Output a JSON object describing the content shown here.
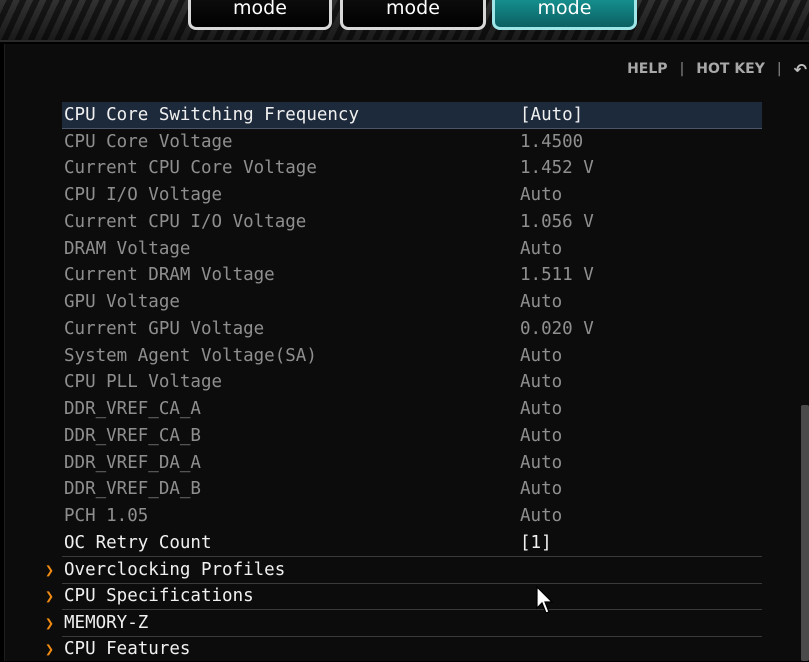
{
  "mode_tabs": [
    {
      "label": "mode",
      "active": false
    },
    {
      "label": "mode",
      "active": false
    },
    {
      "label": "mode",
      "active": true
    }
  ],
  "helpbar": {
    "help": "HELP",
    "separator": "|",
    "hotkey": "HOT KEY",
    "back_icon": "back-arrow-icon"
  },
  "colors": {
    "accent_teal": "#19a3a0",
    "chevron_orange": "#f08a12",
    "selected_row": "#1d2a3b"
  },
  "settings": [
    {
      "label": "CPU Core Switching Frequency",
      "value": "[Auto]"
    },
    {
      "label": "CPU Core Voltage",
      "value": "1.4500"
    },
    {
      "label": "Current CPU Core Voltage",
      "value": "1.452 V"
    },
    {
      "label": "CPU I/O Voltage",
      "value": "Auto"
    },
    {
      "label": "Current CPU I/O Voltage",
      "value": "1.056 V"
    },
    {
      "label": "DRAM Voltage",
      "value": "Auto"
    },
    {
      "label": "Current DRAM Voltage",
      "value": "1.511 V"
    },
    {
      "label": "GPU Voltage",
      "value": "Auto"
    },
    {
      "label": "Current GPU Voltage",
      "value": "0.020 V"
    },
    {
      "label": "System Agent Voltage(SA)",
      "value": "Auto"
    },
    {
      "label": "CPU PLL Voltage",
      "value": "Auto"
    },
    {
      "label": "DDR_VREF_CA_A",
      "value": "Auto"
    },
    {
      "label": "DDR_VREF_CA_B",
      "value": "Auto"
    },
    {
      "label": "DDR_VREF_DA_A",
      "value": "Auto"
    },
    {
      "label": "DDR_VREF_DA_B",
      "value": "Auto"
    },
    {
      "label": "PCH 1.05",
      "value": "Auto"
    },
    {
      "label": "OC Retry Count",
      "value": "[1]"
    }
  ],
  "submenus": [
    {
      "label": "Overclocking Profiles"
    },
    {
      "label": "CPU Specifications"
    },
    {
      "label": "MEMORY-Z"
    },
    {
      "label": "CPU Features"
    }
  ]
}
